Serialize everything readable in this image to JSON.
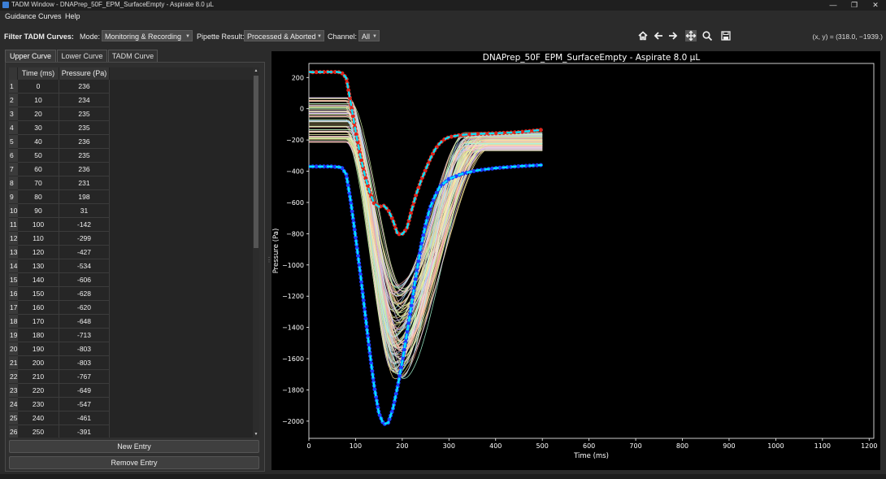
{
  "window": {
    "title": "TADM Window - DNAPrep_50F_EPM_SurfaceEmpty - Aspirate 8.0 µL",
    "controls": [
      "—",
      "❐",
      "✕"
    ]
  },
  "menu": [
    "Guidance Curves",
    "Help"
  ],
  "filter": {
    "label": "Filter TADM Curves:",
    "mode_label": "Mode:",
    "mode_value": "Monitoring & Recording",
    "result_label": "Pipette Result:",
    "result_value": "Processed & Aborted",
    "channel_label": "Channel:",
    "channel_value": "All"
  },
  "nav_icons": [
    "home-icon",
    "back-arrow-icon",
    "forward-arrow-icon",
    "pan-icon",
    "zoom-icon",
    "save-icon"
  ],
  "coords_readout": "(x, y) = (318.0, −1939.)",
  "tabs": [
    {
      "label": "Upper Curve",
      "active": true
    },
    {
      "label": "Lower Curve",
      "active": false
    },
    {
      "label": "TADM Curve",
      "active": false
    }
  ],
  "table": {
    "headers": [
      "Time (ms)",
      "Pressure (Pa)"
    ],
    "rows": [
      [
        "1",
        "0",
        "236"
      ],
      [
        "2",
        "10",
        "234"
      ],
      [
        "3",
        "20",
        "235"
      ],
      [
        "4",
        "30",
        "235"
      ],
      [
        "5",
        "40",
        "236"
      ],
      [
        "6",
        "50",
        "235"
      ],
      [
        "7",
        "60",
        "236"
      ],
      [
        "8",
        "70",
        "231"
      ],
      [
        "9",
        "80",
        "198"
      ],
      [
        "10",
        "90",
        "31"
      ],
      [
        "11",
        "100",
        "-142"
      ],
      [
        "12",
        "110",
        "-299"
      ],
      [
        "13",
        "120",
        "-427"
      ],
      [
        "14",
        "130",
        "-534"
      ],
      [
        "15",
        "140",
        "-606"
      ],
      [
        "16",
        "150",
        "-628"
      ],
      [
        "17",
        "160",
        "-620"
      ],
      [
        "18",
        "170",
        "-648"
      ],
      [
        "19",
        "180",
        "-713"
      ],
      [
        "20",
        "190",
        "-803"
      ],
      [
        "21",
        "200",
        "-803"
      ],
      [
        "22",
        "210",
        "-767"
      ],
      [
        "23",
        "220",
        "-649"
      ],
      [
        "24",
        "230",
        "-547"
      ],
      [
        "25",
        "240",
        "-461"
      ],
      [
        "26",
        "250",
        "-391"
      ]
    ]
  },
  "buttons": {
    "new_entry": "New Entry",
    "remove_entry": "Remove Entry"
  },
  "chart_data": {
    "type": "line",
    "title": "DNAPrep_50F_EPM_SurfaceEmpty - Aspirate 8.0 µL",
    "xlabel": "Time (ms)",
    "ylabel": "Pressure (Pa)",
    "xlim": [
      0,
      1210
    ],
    "ylim": [
      -2110,
      290
    ],
    "xticks": [
      0,
      100,
      200,
      300,
      400,
      500,
      600,
      700,
      800,
      900,
      1000,
      1100,
      1200
    ],
    "yticks": [
      200,
      0,
      -200,
      -400,
      -600,
      -800,
      -1000,
      -1200,
      -1400,
      -1600,
      -1800,
      -2000
    ],
    "background": "#000000",
    "upper_guidance": {
      "color": "#00e5ff",
      "marker_color": "#e0241b",
      "points": [
        [
          0,
          236
        ],
        [
          10,
          234
        ],
        [
          20,
          235
        ],
        [
          30,
          235
        ],
        [
          40,
          236
        ],
        [
          50,
          235
        ],
        [
          60,
          236
        ],
        [
          70,
          231
        ],
        [
          80,
          198
        ],
        [
          90,
          31
        ],
        [
          100,
          -142
        ],
        [
          110,
          -299
        ],
        [
          120,
          -427
        ],
        [
          130,
          -534
        ],
        [
          140,
          -606
        ],
        [
          150,
          -628
        ],
        [
          160,
          -620
        ],
        [
          170,
          -648
        ],
        [
          180,
          -713
        ],
        [
          190,
          -803
        ],
        [
          200,
          -803
        ],
        [
          210,
          -767
        ],
        [
          220,
          -649
        ],
        [
          230,
          -547
        ],
        [
          240,
          -461
        ],
        [
          250,
          -391
        ],
        [
          260,
          -320
        ],
        [
          270,
          -262
        ],
        [
          280,
          -222
        ],
        [
          290,
          -196
        ],
        [
          300,
          -182
        ],
        [
          320,
          -170
        ],
        [
          350,
          -162
        ],
        [
          400,
          -157
        ],
        [
          450,
          -150
        ],
        [
          500,
          -135
        ]
      ]
    },
    "lower_guidance": {
      "color": "#00e5ff",
      "marker_color": "#1f3cff",
      "points": [
        [
          0,
          -370
        ],
        [
          50,
          -370
        ],
        [
          70,
          -375
        ],
        [
          80,
          -420
        ],
        [
          90,
          -600
        ],
        [
          100,
          -820
        ],
        [
          110,
          -1050
        ],
        [
          120,
          -1300
        ],
        [
          130,
          -1550
        ],
        [
          140,
          -1780
        ],
        [
          150,
          -1950
        ],
        [
          160,
          -2020
        ],
        [
          170,
          -2010
        ],
        [
          180,
          -1920
        ],
        [
          190,
          -1780
        ],
        [
          200,
          -1620
        ],
        [
          210,
          -1440
        ],
        [
          220,
          -1250
        ],
        [
          230,
          -1060
        ],
        [
          240,
          -880
        ],
        [
          250,
          -740
        ],
        [
          260,
          -630
        ],
        [
          270,
          -560
        ],
        [
          280,
          -500
        ],
        [
          300,
          -450
        ],
        [
          330,
          -415
        ],
        [
          360,
          -395
        ],
        [
          400,
          -380
        ],
        [
          450,
          -368
        ],
        [
          500,
          -360
        ]
      ]
    },
    "tadm_curves": {
      "count": 100,
      "colors": [
        "#f5d78a",
        "#b9e8a0",
        "#f2a7a0",
        "#c8b6f0",
        "#9fe0ff",
        "#ffd0e6",
        "#d4f2a6",
        "#fff2a8",
        "#a8ffd8",
        "#ffb3a7",
        "#e0c8ff",
        "#f0f0a0"
      ],
      "start_range": [
        -215,
        80
      ],
      "trough_range": [
        -1730,
        -1120
      ],
      "end_range": [
        -270,
        -150
      ]
    }
  }
}
